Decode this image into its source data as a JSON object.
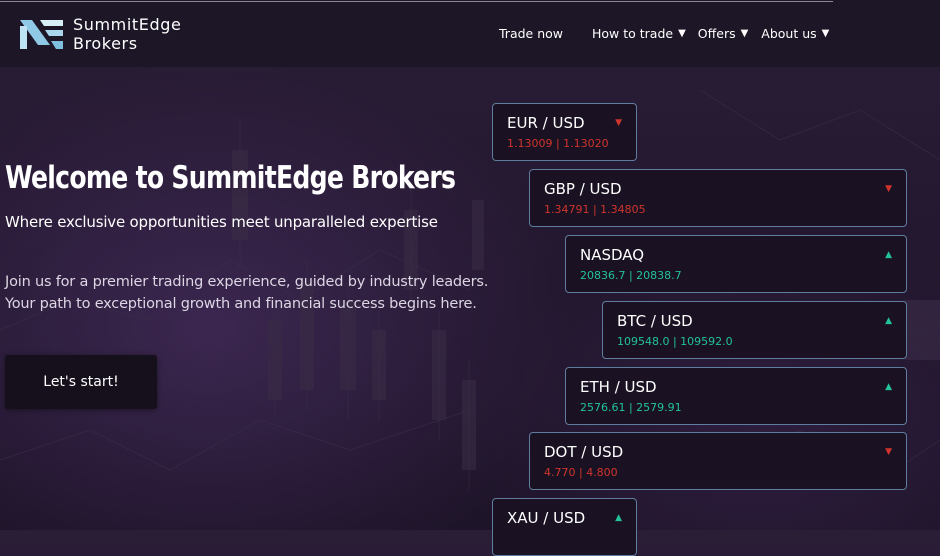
{
  "brand": {
    "line1": "SummitEdge",
    "line2": "Brokers",
    "logo_icon": "summitedge-logo-mark"
  },
  "nav": {
    "trade_now": "Trade now",
    "how_to_trade": "How to trade",
    "offers": "Offers",
    "about_us": "About us",
    "caret": "▼"
  },
  "hero": {
    "title": "Welcome to SummitEdge Brokers",
    "subtitle": "Where exclusive opportunities meet unparalleled expertise",
    "body_line1": "Join us for a premier trading experience, guided by industry leaders.",
    "body_line2": "Your path to exceptional growth and financial success begins here.",
    "cta": "Let's start!"
  },
  "tickers": [
    {
      "pair": "EUR / USD",
      "quote": "1.13009 | 1.13020",
      "trend": "down",
      "arrow": "▼"
    },
    {
      "pair": "GBP / USD",
      "quote": "1.34791 | 1.34805",
      "trend": "down",
      "arrow": "▼"
    },
    {
      "pair": "NASDAQ",
      "quote": "20836.7 | 20838.7",
      "trend": "up",
      "arrow": "▲"
    },
    {
      "pair": "BTC / USD",
      "quote": "109548.0 | 109592.0",
      "trend": "up",
      "arrow": "▲"
    },
    {
      "pair": "ETH / USD",
      "quote": "2576.61 | 2579.91",
      "trend": "up",
      "arrow": "▲"
    },
    {
      "pair": "DOT / USD",
      "quote": "4.770 | 4.800",
      "trend": "down",
      "arrow": "▼"
    },
    {
      "pair": "XAU / USD",
      "quote": "",
      "trend": "up",
      "arrow": "▲"
    }
  ],
  "colors": {
    "background": "#251930",
    "header": "#1c1626",
    "card_border": "#5f7d9f",
    "down": "#d0342c",
    "up": "#22c29a"
  }
}
